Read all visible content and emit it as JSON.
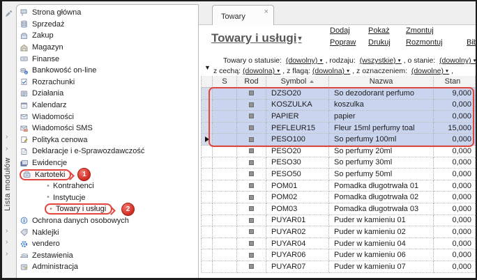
{
  "window": {
    "modules_panel_label": "Lista modułów"
  },
  "colors": {
    "annotation_red": "#e2453e",
    "selection_blue": "#c9d4ee",
    "vendero_blue": "#3c7fd0"
  },
  "sidebar": {
    "items": [
      {
        "label": "Strona główna"
      },
      {
        "label": "Sprzedaż"
      },
      {
        "label": "Zakup"
      },
      {
        "label": "Magazyn"
      },
      {
        "label": "Finanse"
      },
      {
        "label": "Bankowość on-line"
      },
      {
        "label": "Rozrachunki"
      },
      {
        "label": "Działania"
      },
      {
        "label": "Kalendarz"
      },
      {
        "label": "Wiadomości"
      },
      {
        "label": "Wiadomości SMS"
      },
      {
        "label": "Polityka cenowa",
        "expandable": true
      },
      {
        "label": "Deklaracje i e-Sprawozdawczość",
        "expandable": true
      },
      {
        "label": "Ewidencje",
        "expandable": true
      },
      {
        "label": "Kartoteki",
        "annotation_badge": "1"
      },
      {
        "label": "Kontrahenci",
        "sub": true
      },
      {
        "label": "Instytucje",
        "sub": true
      },
      {
        "label": "Towary i usługi",
        "sub": true,
        "annotation_badge": "2"
      },
      {
        "label": "Ochrona danych osobowych"
      },
      {
        "label": "Naklejki",
        "expandable": true
      },
      {
        "label": "vendero",
        "expandable": true
      },
      {
        "label": "Zestawienia",
        "expandable": true
      },
      {
        "label": "Administracja"
      }
    ]
  },
  "annotations": {
    "step1": "1",
    "step2": "2"
  },
  "tabbar": {
    "active_tab": "Towary",
    "close_glyph": "×"
  },
  "header": {
    "title": "Towary i usługi",
    "actions_row1": [
      "Dodaj",
      "Pokaż",
      "Zmontuj"
    ],
    "actions_row2": [
      "Popraw",
      "Drukuj",
      "Rozmontuj",
      "Biblioteka"
    ]
  },
  "filters": {
    "line1": [
      {
        "text": "Towary o statusie:  "
      },
      {
        "link": "(dowolny)"
      },
      {
        "text": " , rodzaju:  "
      },
      {
        "link": "(wszystkie)"
      },
      {
        "text": " , o stanie:  "
      },
      {
        "link": "(dowolny)"
      }
    ],
    "line2": [
      {
        "text": "z cechą: "
      },
      {
        "link": "(dowolna)"
      },
      {
        "text": " , z flagą: "
      },
      {
        "link": "(dowolna)"
      },
      {
        "text": " , z oznaczeniem:  "
      },
      {
        "link": "(dowolne)"
      },
      {
        "text": " ,"
      }
    ]
  },
  "table": {
    "columns": [
      "",
      "S",
      "Rod",
      "Symbol",
      "Nazwa",
      "Stan"
    ],
    "rows": [
      {
        "symbol": "DZSO20",
        "nazwa": "So dezodorant perfumo",
        "stan": "9,000",
        "selected": true
      },
      {
        "symbol": "KOSZULKA",
        "nazwa": "koszulka",
        "stan": "0,000",
        "selected": true
      },
      {
        "symbol": "PAPIER",
        "nazwa": "papier",
        "stan": "0,000",
        "selected": true
      },
      {
        "symbol": "PEFLEUR15",
        "nazwa": "Fleur 15ml perfumy toal",
        "stan": "15,000",
        "selected": true
      },
      {
        "symbol": "PESO100",
        "nazwa": "So perfumy 100ml",
        "stan": "0,000",
        "selected": true,
        "current": true
      },
      {
        "symbol": "PESO20",
        "nazwa": "So perfumy 20ml",
        "stan": "0,000"
      },
      {
        "symbol": "PESO30",
        "nazwa": "So perfumy 30ml",
        "stan": "0,000"
      },
      {
        "symbol": "PESO50",
        "nazwa": "So perfumy 50ml",
        "stan": "0,000"
      },
      {
        "symbol": "POM01",
        "nazwa": "Pomadka długotrwała 01",
        "stan": "0,000"
      },
      {
        "symbol": "POM02",
        "nazwa": "Pomadka długotrwała 02",
        "stan": "0,000"
      },
      {
        "symbol": "POM03",
        "nazwa": "Pomadka długotrwała 03",
        "stan": "0,000"
      },
      {
        "symbol": "PUYAR01",
        "nazwa": "Puder w kamieniu 01",
        "stan": "0,000"
      },
      {
        "symbol": "PUYAR02",
        "nazwa": "Puder w kamieniu 02",
        "stan": "0,000"
      },
      {
        "symbol": "PUYAR04",
        "nazwa": "Puder w kamieniu 04",
        "stan": "0,000"
      },
      {
        "symbol": "PUYAR06",
        "nazwa": "Puder w kamieniu 06",
        "stan": "0,000"
      },
      {
        "symbol": "PUYAR07",
        "nazwa": "Puder w kamieniu 07",
        "stan": "0,000"
      }
    ]
  }
}
